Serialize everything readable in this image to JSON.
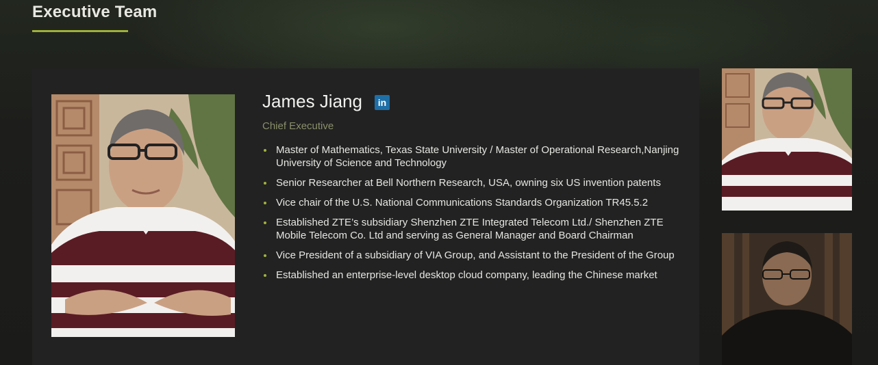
{
  "section": {
    "title": "Executive Team"
  },
  "executive": {
    "name": "James Jiang",
    "linkedin_label": "in",
    "role": "Chief Executive",
    "bullets": [
      "Master of Mathematics, Texas State University / Master of Operational Research,Nanjing University of Science and Technology",
      "Senior Researcher at Bell Northern Research, USA, owning six US invention patents",
      "Vice chair of the U.S. National Communications Standards Organization TR45.5.2",
      "Established ZTE’s subsidiary Shenzhen ZTE Integrated Telecom Ltd./ Shenzhen ZTE Mobile Telecom Co. Ltd and serving as General Manager and Board Chairman",
      "Vice President of a subsidiary of VIA Group, and Assistant to the President of the Group",
      "Established an enterprise-level desktop cloud company, leading the Chinese market"
    ]
  },
  "colors": {
    "accent": "#9fb13a",
    "card_bg": "#222222",
    "linkedin": "#1e6fa7",
    "role_text": "#8a8f6a"
  },
  "icons": {
    "linkedin": "linkedin-icon"
  }
}
